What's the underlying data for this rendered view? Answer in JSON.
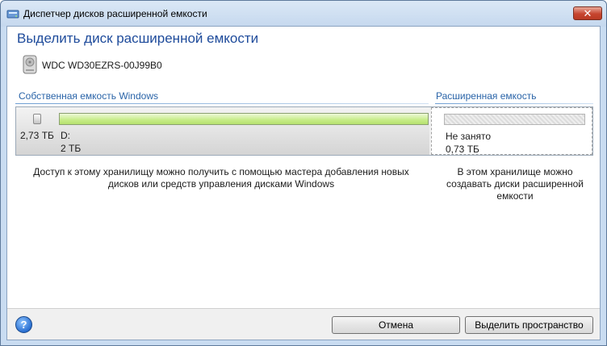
{
  "window": {
    "title": "Диспетчер дисков расширенной емкости",
    "close_glyph": "✕"
  },
  "header": {
    "heading": "Выделить диск расширенной емкости",
    "disk_name": "WDC WD30EZRS-00J99B0"
  },
  "sections": {
    "own_label": "Собственная емкость Windows",
    "ext_label": "Расширенная емкость"
  },
  "disk": {
    "total_size": "2,73 ТБ",
    "volume_label": "D:",
    "volume_size": "2 ТБ",
    "free_label": "Не занято",
    "free_size": "0,73 ТБ"
  },
  "descriptions": {
    "own_line1": "Доступ к этому хранилищу можно получить с помощью мастера добавления новых",
    "own_line2": "дисков или средств управления дисками Windows",
    "ext_line1": "В этом хранилище можно",
    "ext_line2": "создавать диски расширенной",
    "ext_line3": "емкости"
  },
  "footer": {
    "help_glyph": "?",
    "cancel_label": "Отмена",
    "allocate_label": "Выделить пространство"
  },
  "icons": {
    "app": "disk-manager-icon",
    "disk": "hard-disk-icon",
    "help": "help-icon"
  },
  "colors": {
    "heading": "#1e4b9b",
    "section_label": "#2a64a8",
    "volume_bar": "#c6ec87",
    "close_button": "#c6452f"
  }
}
